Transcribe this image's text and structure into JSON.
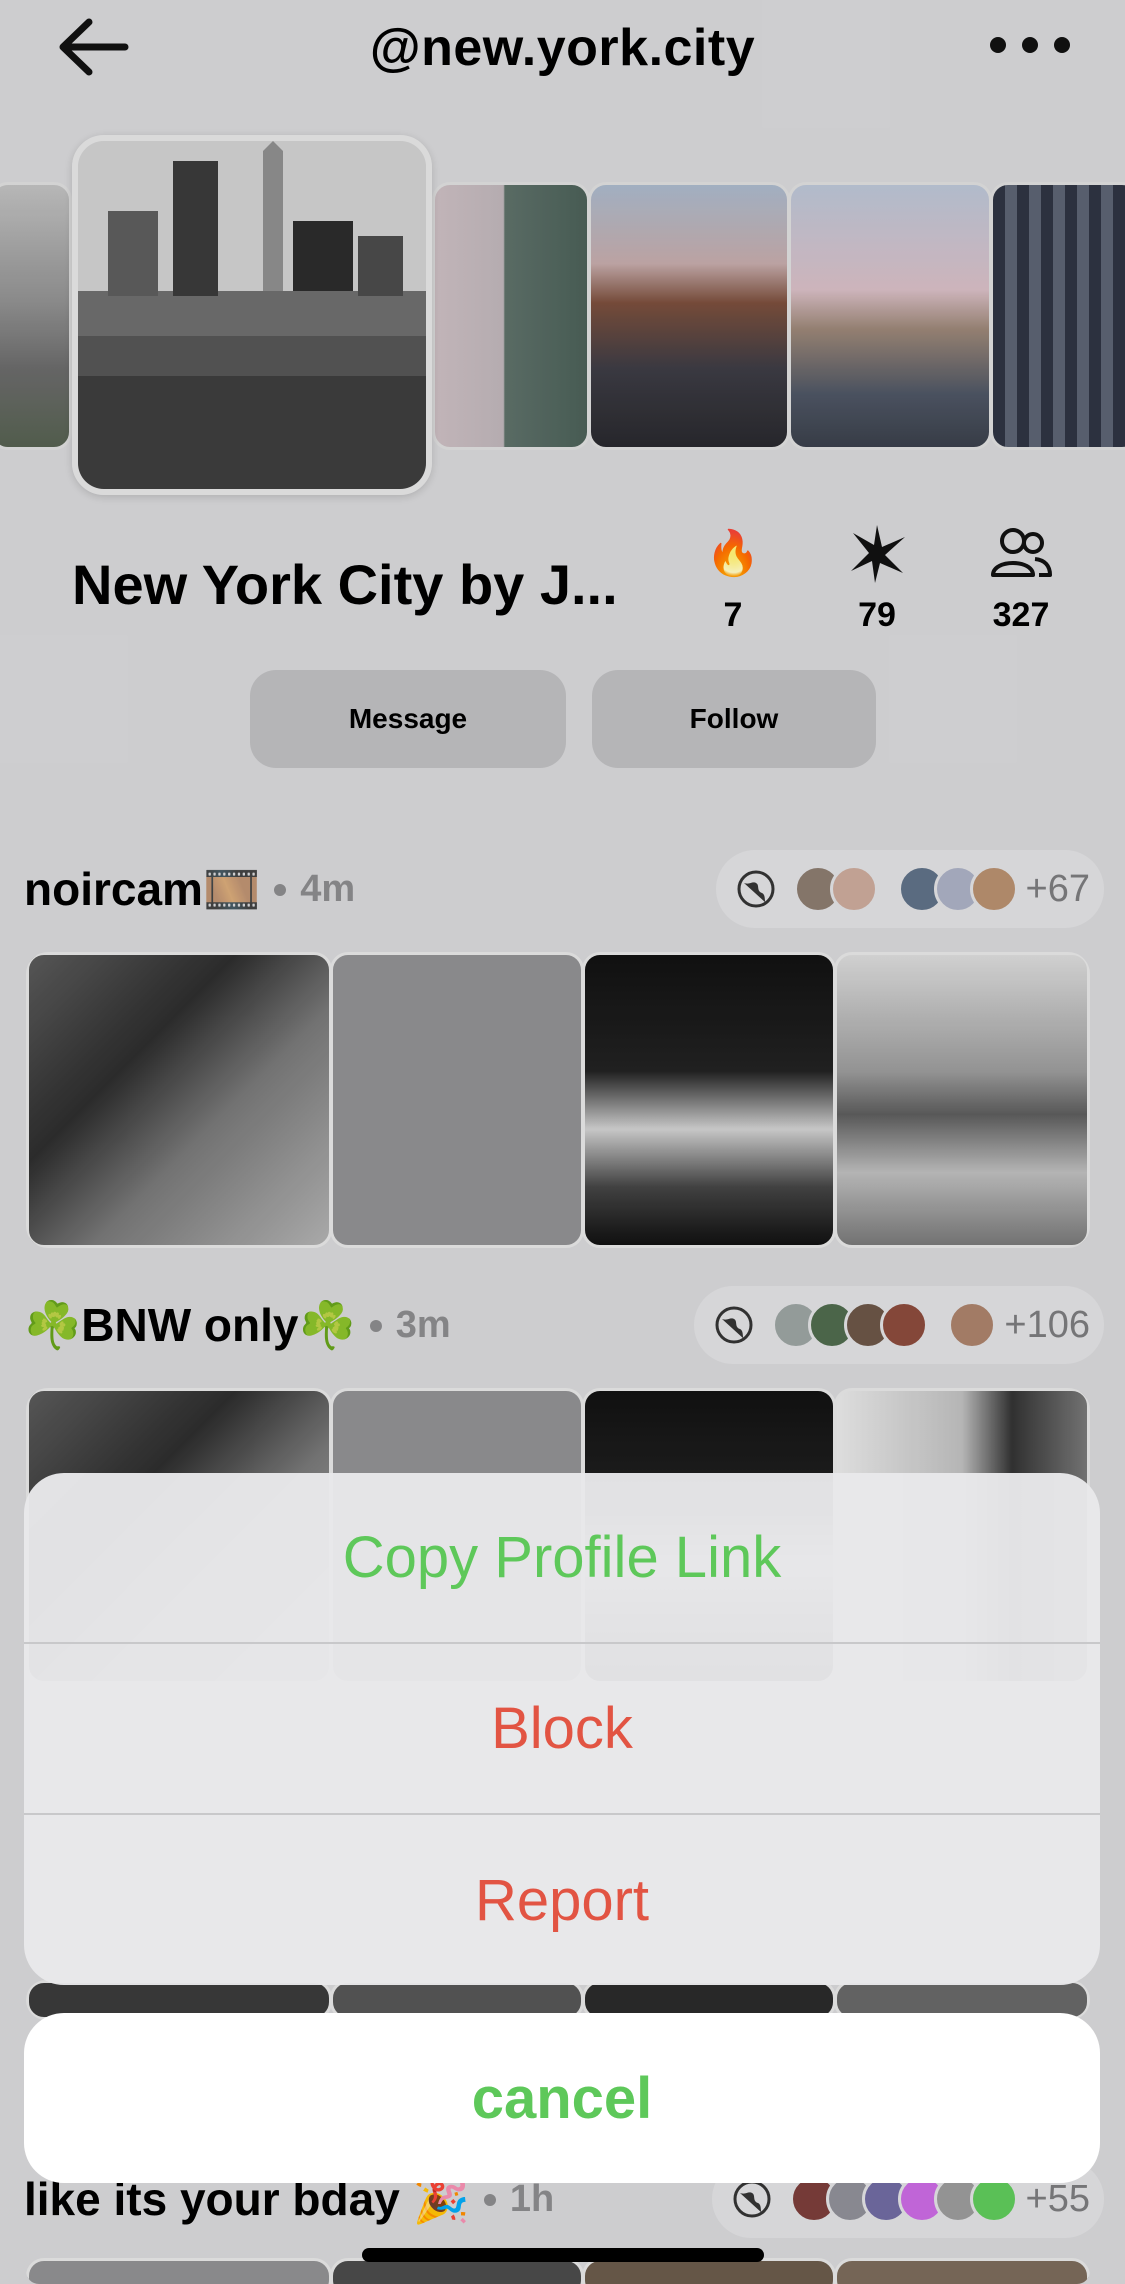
{
  "header": {
    "handle": "@new.york.city",
    "back_icon": "arrow-left-icon",
    "more_icon": "ellipsis-icon"
  },
  "profile": {
    "name": "New York City by J...",
    "stats": [
      {
        "icon": "fire-icon",
        "value": "7"
      },
      {
        "icon": "sparkle-icon",
        "value": "79"
      },
      {
        "icon": "people-icon",
        "value": "327"
      }
    ],
    "message_label": "Message",
    "follow_label": "Follow"
  },
  "feed": {
    "posts": [
      {
        "title": "noircam🎞️",
        "time": "4m",
        "more": "+67"
      },
      {
        "title": "☘️BNW only☘️",
        "time": "3m",
        "more": "+106"
      },
      {
        "title": "like its your bday 🎉",
        "time": "1h",
        "more": "+55"
      }
    ]
  },
  "action_sheet": {
    "copy_link": "Copy Profile Link",
    "block": "Block",
    "report": "Report",
    "cancel": "cancel"
  },
  "colors": {
    "accent_green": "#5ec85a",
    "danger_red": "#e25443",
    "background": "#d6d6d8"
  }
}
